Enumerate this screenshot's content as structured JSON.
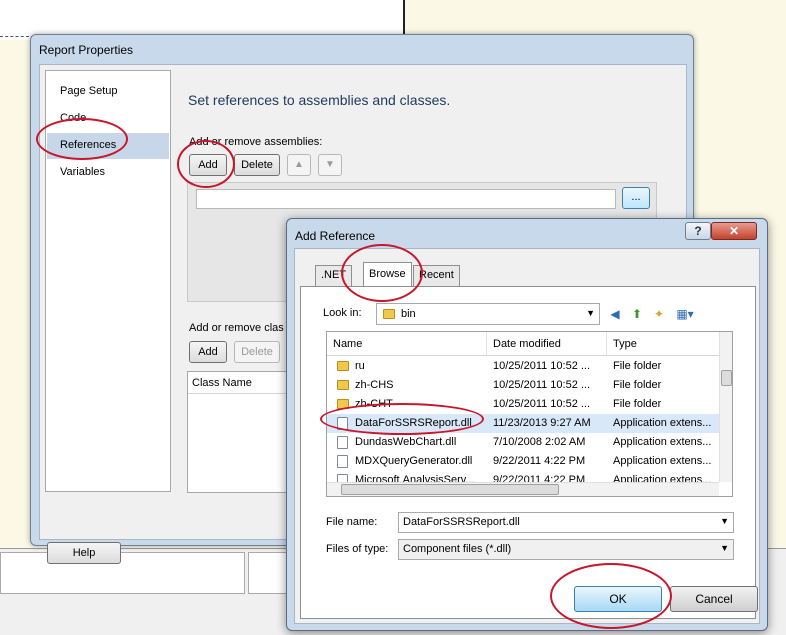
{
  "report_properties": {
    "title": "Report Properties",
    "nav": [
      "Page Setup",
      "Code",
      "References",
      "Variables"
    ],
    "selected_nav": "References",
    "heading": "Set references to assemblies and classes.",
    "assemblies_label": "Add or remove assemblies:",
    "add_label": "Add",
    "delete_label": "Delete",
    "up_icon": "up-arrow-icon",
    "down_icon": "down-arrow-icon",
    "browse_label": "...",
    "classes_label": "Add or remove clas",
    "classes_add_label": "Add",
    "classes_delete_label": "Delete",
    "class_name_header": "Class Name",
    "help_label": "Help"
  },
  "add_reference": {
    "title": "Add Reference",
    "help_icon": "?",
    "close_icon": "close-icon",
    "tabs": [
      ".NET",
      "Browse",
      "Recent"
    ],
    "selected_tab": "Browse",
    "look_in_label": "Look in:",
    "look_in_value": "bin",
    "columns": [
      "Name",
      "Date modified",
      "Type"
    ],
    "files": [
      {
        "name": "ru",
        "date": "10/25/2011 10:52 ...",
        "type": "File folder"
      },
      {
        "name": "zh-CHS",
        "date": "10/25/2011 10:52 ...",
        "type": "File folder"
      },
      {
        "name": "zh-CHT",
        "date": "10/25/2011 10:52 ...",
        "type": "File folder"
      },
      {
        "name": "DataForSSRSReport.dll",
        "date": "11/23/2013 9:27 AM",
        "type": "Application extens..."
      },
      {
        "name": "DundasWebChart.dll",
        "date": "7/10/2008 2:02 AM",
        "type": "Application extens..."
      },
      {
        "name": "MDXQueryGenerator.dll",
        "date": "9/22/2011 4:22 PM",
        "type": "Application extens..."
      },
      {
        "name": "Microsoft.AnalysisServ...",
        "date": "9/22/2011 4:22 PM",
        "type": "Application extens..."
      }
    ],
    "file_name_label": "File name:",
    "file_name_value": "DataForSSRSReport.dll",
    "file_type_label": "Files of type:",
    "file_type_value": "Component files (*.dll)",
    "ok_label": "OK",
    "cancel_label": "Cancel"
  },
  "colors": {
    "annotation": "#c8162b",
    "selection": "#d9e8f9",
    "window_frame": "#c9d9ec"
  }
}
